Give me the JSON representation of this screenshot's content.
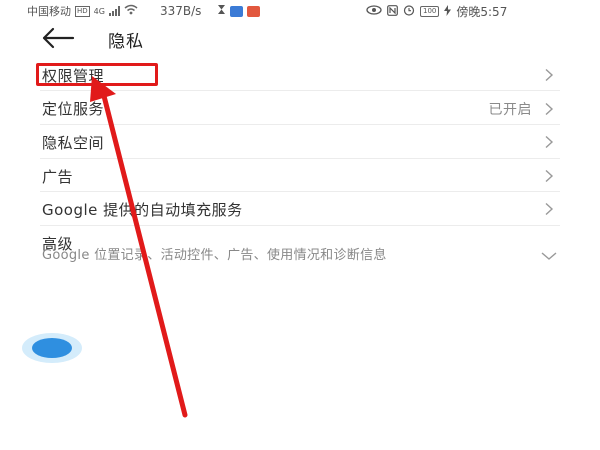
{
  "status_bar": {
    "carrier": "中国移动",
    "hd_badge": "HD",
    "network": "4G",
    "speed": "337B/s",
    "battery": "100",
    "time": "傍晚5:57",
    "icons": [
      "signal-bars-icon",
      "wifi-icon",
      "hourglass-icon",
      "app-icon",
      "weibo-icon",
      "nfc-icon",
      "alarm-icon",
      "battery-icon",
      "charging-icon"
    ]
  },
  "header": {
    "title": "隐私",
    "back_icon": "arrow-left-icon"
  },
  "items": [
    {
      "label": "权限管理",
      "value": "",
      "chevron": "chevron-right"
    },
    {
      "label": "定位服务",
      "value": "已开启",
      "chevron": "chevron-right"
    },
    {
      "label": "隐私空间",
      "value": "",
      "chevron": "chevron-right"
    },
    {
      "label": "广告",
      "value": "",
      "chevron": "chevron-right"
    },
    {
      "label": "Google 提供的自动填充服务",
      "value": "",
      "chevron": "chevron-right"
    }
  ],
  "advanced": {
    "label": "高级",
    "summary": "Google 位置记录、活动控件、广告、使用情况和诊断信息",
    "chevron": "chevron-down"
  },
  "annotation": {
    "highlight_color": "#e11a1a",
    "target": "权限管理"
  },
  "floating_ball": {
    "color": "#2f8fe0"
  }
}
